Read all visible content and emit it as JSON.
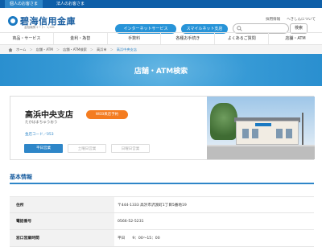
{
  "topbar": {
    "tab_personal": "個人のお客さま",
    "tab_corporate": "法人のお客さま"
  },
  "header": {
    "logo_text": "碧海信用金庫",
    "logo_sub": "金融機関コード：1,561",
    "util_links": [
      "採用情報",
      "へきしんについて"
    ],
    "btn_internet": "インターネットサービス",
    "btn_smile": "スマイルネット支店",
    "search_placeholder": "",
    "btn_search": "検索"
  },
  "nav": {
    "items": [
      "商品・サービス",
      "金利・為替",
      "手数料",
      "各種お手続き",
      "よくあるご質問",
      "店舗・ATM"
    ]
  },
  "breadcrumb": {
    "home": "ホーム",
    "items": [
      "店舗・ATM",
      "店舗・ATM検索",
      "高浜市"
    ],
    "current": "高浜中央支店"
  },
  "banner": {
    "title": "店舗・ATM検索"
  },
  "branch": {
    "name": "高浜中央支店",
    "kana": "たかはまちゅうおう",
    "code": "金店コード／053",
    "web_badge": "WEB来店予約",
    "buttons": [
      "平日営業",
      "土曜日営業",
      "日曜日営業"
    ]
  },
  "basic_info": {
    "title": "基本情報",
    "rows": [
      {
        "label": "住所",
        "value": "〒444-1333 高浜市沢渡町1丁目5番地19"
      },
      {
        "label": "電話番号",
        "value": "0566-52-5231"
      },
      {
        "label": "窓口営業時間",
        "value": "平日　　9：00〜15：00"
      }
    ]
  },
  "colors": {
    "brand_blue": "#2e86c8",
    "accent_orange": "#f47c20"
  }
}
